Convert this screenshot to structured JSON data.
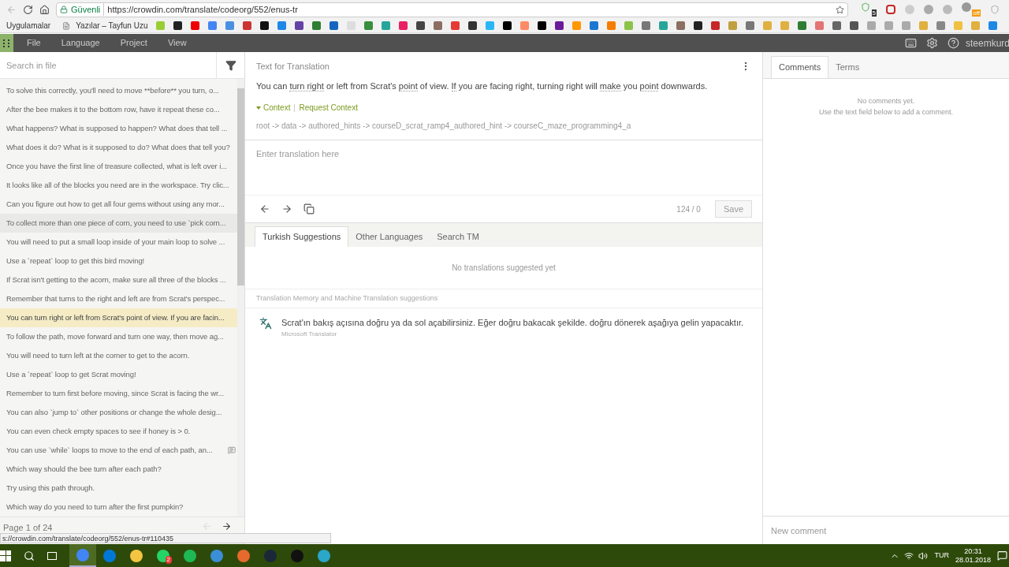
{
  "browser": {
    "security_label": "Güvenli",
    "url": "https://crowdin.com/translate/codeorg/552/enus-tr",
    "extension_badges": [
      "5",
      "off"
    ],
    "bookmarks": [
      "Uygulamalar",
      "Yazılar – Tayfun Uzu"
    ]
  },
  "menu": {
    "items": [
      "File",
      "Language",
      "Project",
      "View"
    ],
    "username": "steemkurd"
  },
  "sidebar": {
    "search": {
      "placeholder": "Search in file"
    },
    "items": [
      {
        "text": "To solve this correctly, you'll need to move **before** you turn, o...",
        "selected": false,
        "hovered": false,
        "has_comment": false
      },
      {
        "text": "After the bee makes it to the bottom row, have it repeat these co...",
        "selected": false,
        "hovered": false,
        "has_comment": false
      },
      {
        "text": "What happens? What is supposed to happen? What does that tell ...",
        "selected": false,
        "hovered": false,
        "has_comment": false
      },
      {
        "text": "What does it do? What is it supposed to do? What does that tell you?",
        "selected": false,
        "hovered": false,
        "has_comment": false
      },
      {
        "text": "Once you have the first line of treasure collected, what is left over i...",
        "selected": false,
        "hovered": false,
        "has_comment": false
      },
      {
        "text": "It looks like all of the blocks you need are in the workspace. Try clic...",
        "selected": false,
        "hovered": false,
        "has_comment": false
      },
      {
        "text": "Can you figure out how to get all four gems without using any mor...",
        "selected": false,
        "hovered": false,
        "has_comment": false
      },
      {
        "text": "To collect more than one piece of corn, you need to use `pick corn...",
        "selected": false,
        "hovered": true,
        "has_comment": false
      },
      {
        "text": "You will need to put a small loop inside of your main loop to solve ...",
        "selected": false,
        "hovered": false,
        "has_comment": false
      },
      {
        "text": "Use a `repeat` loop to get this bird moving!",
        "selected": false,
        "hovered": false,
        "has_comment": false
      },
      {
        "text": "If Scrat isn't getting to the acorn, make sure all three of the blocks ...",
        "selected": false,
        "hovered": false,
        "has_comment": false
      },
      {
        "text": "Remember that turns to the right and left are from Scrat's perspec...",
        "selected": false,
        "hovered": false,
        "has_comment": false
      },
      {
        "text": "You can turn right or left from Scrat's point of view. If you are facin...",
        "selected": true,
        "hovered": false,
        "has_comment": false
      },
      {
        "text": "To follow the path, move forward and turn one way, then move ag...",
        "selected": false,
        "hovered": false,
        "has_comment": false
      },
      {
        "text": "You will need to turn left at the corner to get to the acorn.",
        "selected": false,
        "hovered": false,
        "has_comment": false
      },
      {
        "text": "Use a `repeat` loop to get Scrat moving!",
        "selected": false,
        "hovered": false,
        "has_comment": false
      },
      {
        "text": "Remember to turn first before moving, since Scrat is facing the wr...",
        "selected": false,
        "hovered": false,
        "has_comment": false
      },
      {
        "text": "You can also `jump to` other positions or change the whole desig...",
        "selected": false,
        "hovered": false,
        "has_comment": false
      },
      {
        "text": "You can even check empty spaces to see if honey is > 0.",
        "selected": false,
        "hovered": false,
        "has_comment": false
      },
      {
        "text": "You can use `while` loops to move to the end of each path, an...",
        "selected": false,
        "hovered": false,
        "has_comment": true
      },
      {
        "text": "Which way should the bee turn after each path?",
        "selected": false,
        "hovered": false,
        "has_comment": false
      },
      {
        "text": "Try using this path through.",
        "selected": false,
        "hovered": false,
        "has_comment": false
      },
      {
        "text": "Which way do you need to turn after the first pumpkin?",
        "selected": false,
        "hovered": false,
        "has_comment": false
      }
    ],
    "pagination": "Page 1 of 24"
  },
  "source": {
    "heading": "Text for Translation",
    "segments": [
      {
        "text": "You can ",
        "term": false
      },
      {
        "text": "turn right",
        "term": true
      },
      {
        "text": " or left from Scrat's ",
        "term": false
      },
      {
        "text": "point",
        "term": true
      },
      {
        "text": " of view. ",
        "term": false
      },
      {
        "text": "If",
        "term": true
      },
      {
        "text": " you are facing right, turning right will ",
        "term": false
      },
      {
        "text": "make",
        "term": true
      },
      {
        "text": " you ",
        "term": false
      },
      {
        "text": "point",
        "term": true
      },
      {
        "text": " downwards.",
        "term": false
      }
    ],
    "context_toggle": "Context",
    "request_context": "Request Context",
    "context_path": "root -> data -> authored_hints -> courseD_scrat_ramp4_authored_hint -> courseC_maze_programming4_a"
  },
  "editor": {
    "placeholder": "Enter translation here",
    "counter": "124 / 0",
    "save": "Save"
  },
  "suggestion_tabs": [
    {
      "label": "Turkish Suggestions",
      "selected": true
    },
    {
      "label": "Other Languages",
      "selected": false
    },
    {
      "label": "Search TM",
      "selected": false
    }
  ],
  "suggestions": {
    "empty": "No translations suggested yet",
    "tm_heading": "Translation Memory and Machine Translation suggestions",
    "machine": [
      {
        "text": "Scrat'ın bakış açısına doğru ya da sol açabilirsiniz. Eğer doğru bakacak şekilde. doğru dönerek aşağıya gelin yapacaktır.",
        "source": "Microsoft Translator"
      }
    ]
  },
  "comments": {
    "tabs": [
      {
        "label": "Comments",
        "selected": true
      },
      {
        "label": "Terms",
        "selected": false
      }
    ],
    "empty": [
      "No comments yet.",
      "Use the text field below to add a comment."
    ],
    "placeholder": "New comment"
  },
  "status_url": "s://crowdin.com/translate/codeorg/552/enus-tr#110435",
  "taskbar": {
    "whatsapp_badge": "2",
    "language": "TUR",
    "time": "20:31",
    "date": "28.01.2018"
  }
}
